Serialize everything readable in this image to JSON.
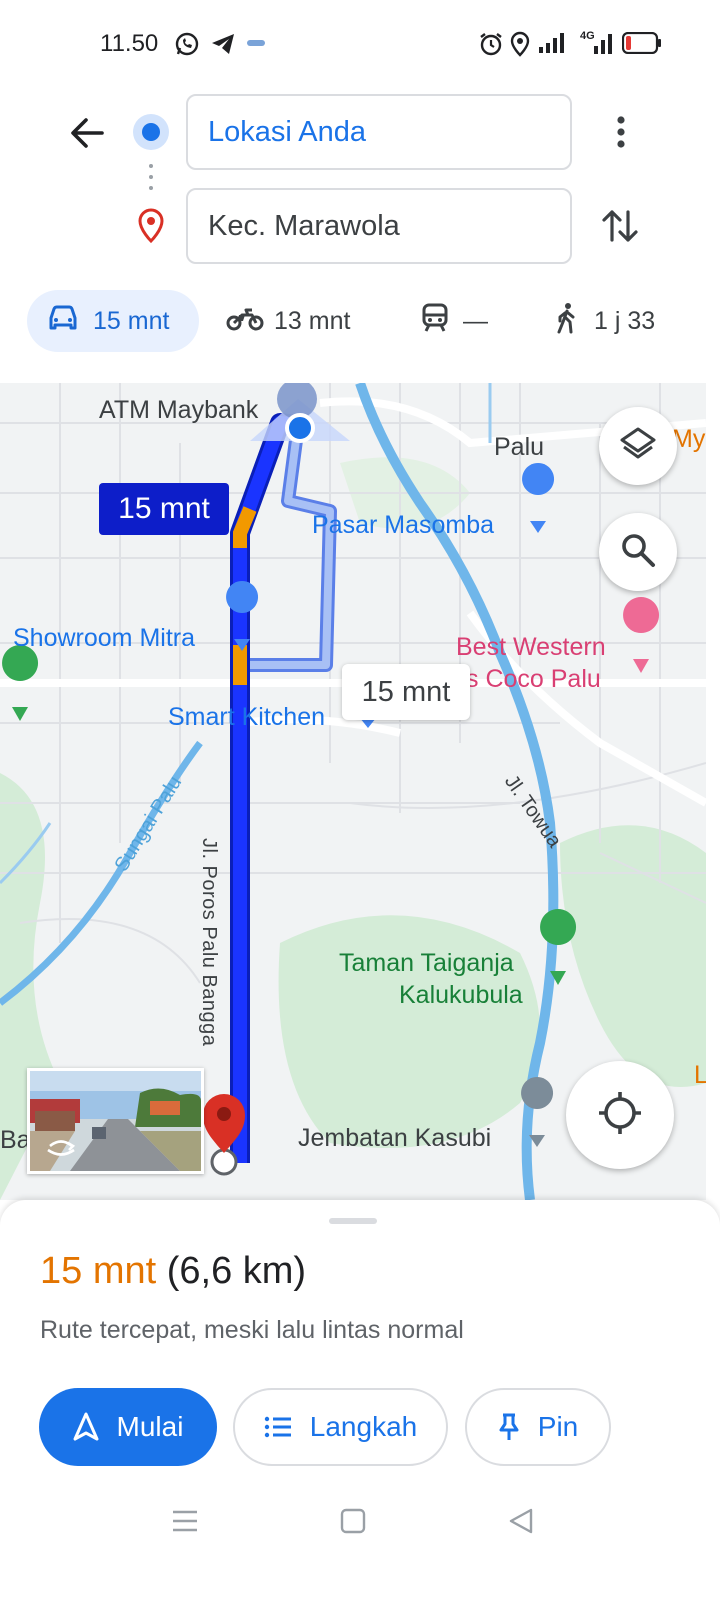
{
  "status_bar": {
    "time": "11.50",
    "icons": [
      "whatsapp-icon",
      "telegram-icon",
      "notification-icon",
      "alarm-icon",
      "location-icon",
      "signal-icon",
      "4g-signal-icon",
      "battery-low-icon"
    ],
    "network": "4G"
  },
  "search": {
    "origin": "Lokasi Anda",
    "destination": "Kec. Marawola"
  },
  "travel_modes": [
    {
      "mode": "car",
      "icon": "car-icon",
      "label": "15 mnt",
      "selected": true
    },
    {
      "mode": "motorcycle",
      "icon": "motorcycle-icon",
      "label": "13 mnt",
      "selected": false
    },
    {
      "mode": "transit",
      "icon": "train-icon",
      "label": "—",
      "selected": false
    },
    {
      "mode": "walk",
      "icon": "walk-icon",
      "label": "1 j 33",
      "selected": false
    }
  ],
  "map": {
    "labels": {
      "atm": "ATM Maybank",
      "palu": "Palu",
      "my": "My",
      "pasar": "Pasar Masomba",
      "showroom": "Showroom Mitra",
      "best_western_1": "Best Western",
      "best_western_2": "s Coco Palu",
      "smart_kitchen": "Smart Kitchen",
      "jl_towua": "Jl. Towua",
      "sungai_palu": "Sungai Palu",
      "jl_poros": "Jl. Poros Palu Bangga",
      "taman_1": "Taman Taiganja",
      "taman_2": "Kalukubula",
      "jembatan": "Jembatan Kasubi",
      "bal": "Bal",
      "edge_l": "L"
    },
    "route_label": "15 mnt",
    "alt_route_label": "15 mnt",
    "colors": {
      "route": "#1a34ff",
      "traffic": "#f29900",
      "alt_route": "#a8c0f5",
      "destination_pin": "#d93025"
    }
  },
  "summary": {
    "duration": "15 mnt",
    "distance": "(6,6 km)",
    "description": "Rute tercepat, meski lalu lintas normal"
  },
  "actions": {
    "start": "Mulai",
    "steps": "Langkah",
    "pin": "Pin"
  },
  "accent_color": "#1a73e8"
}
